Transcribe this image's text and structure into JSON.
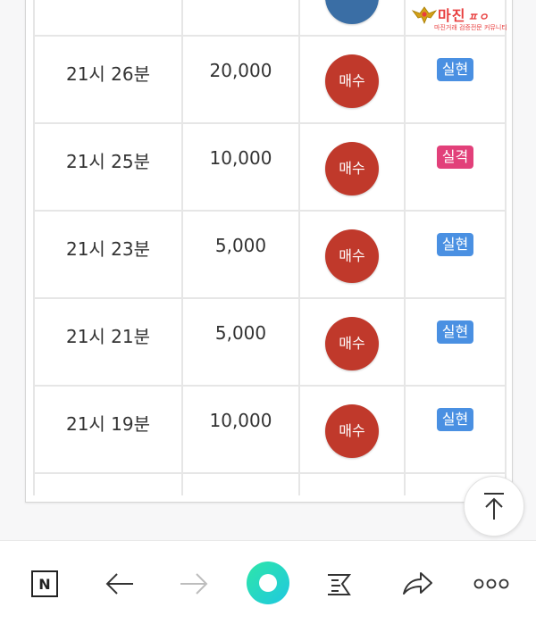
{
  "logo": {
    "name": "마진",
    "suffix": "ㅍㅇ",
    "tagline": "마진거래 검증전문 커뮤니티"
  },
  "table": {
    "rows": [
      {
        "time": "21시 26분",
        "amount": "20,000",
        "action": "매수",
        "result": "실현",
        "result_color": "#4a90e2"
      },
      {
        "time": "21시 25분",
        "amount": "10,000",
        "action": "매수",
        "result": "실격",
        "result_color": "#e2407a"
      },
      {
        "time": "21시 23분",
        "amount": "5,000",
        "action": "매수",
        "result": "실현",
        "result_color": "#4a90e2"
      },
      {
        "time": "21시 21분",
        "amount": "5,000",
        "action": "매수",
        "result": "실현",
        "result_color": "#4a90e2"
      },
      {
        "time": "21시 19분",
        "amount": "10,000",
        "action": "매수",
        "result": "실현",
        "result_color": "#4a90e2"
      }
    ]
  },
  "toolbar": {
    "home_label": "N"
  },
  "colors": {
    "buy_badge": "#c0392b",
    "partial_badge": "#3a6ea5",
    "tag_blue": "#4a90e2",
    "tag_pink": "#e2407a",
    "logo_red": "#e83e3e"
  }
}
